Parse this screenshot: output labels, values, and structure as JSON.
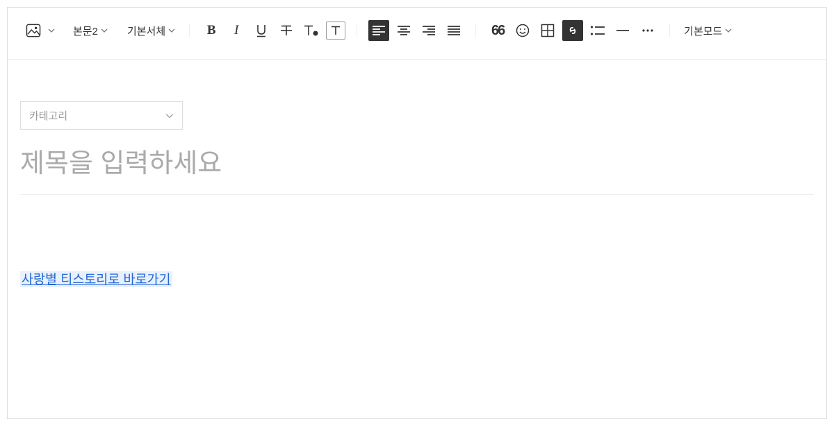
{
  "toolbar": {
    "paragraph_style": "본문2",
    "font_family": "기본서체",
    "mode": "기본모드"
  },
  "content": {
    "category_placeholder": "카테고리",
    "title_placeholder": "제목을 입력하세요",
    "link_text": "사랑별 티스토리로 바로가기"
  }
}
